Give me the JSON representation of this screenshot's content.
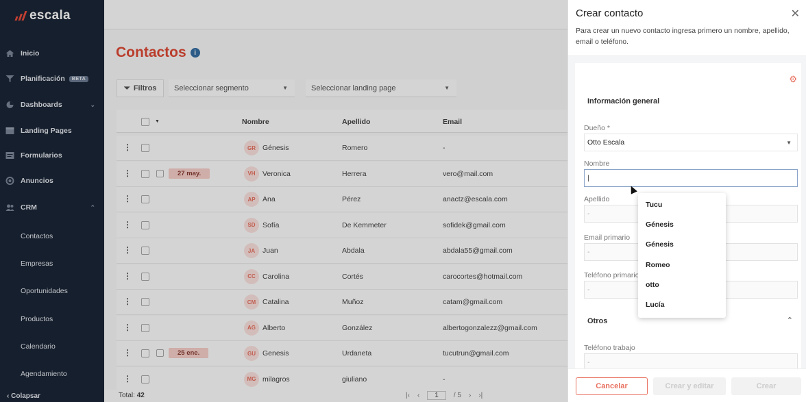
{
  "sidebar": {
    "brand": "escala",
    "nav": [
      {
        "label": "Inicio",
        "icon": "home-icon"
      },
      {
        "label": "Planificación",
        "icon": "filter-icon",
        "badge": "BETA"
      },
      {
        "label": "Dashboards",
        "icon": "pie-chart-icon"
      },
      {
        "label": "Landing Pages",
        "icon": "landing-page-icon"
      },
      {
        "label": "Formularios",
        "icon": "form-icon"
      },
      {
        "label": "Anuncios",
        "icon": "ads-icon"
      },
      {
        "label": "CRM",
        "icon": "users-icon"
      }
    ],
    "crm_items": [
      "Contactos",
      "Empresas",
      "Oportunidades",
      "Productos",
      "Calendario",
      "Agendamiento"
    ],
    "collapse_label": "Colapsar"
  },
  "main": {
    "title": "Contactos",
    "filters_label": "Filtros",
    "segment_placeholder": "Seleccionar segmento",
    "landing_placeholder": "Seleccionar landing page",
    "columns": [
      "Nombre",
      "Apellido",
      "Email"
    ],
    "rows": [
      {
        "initials": "GR",
        "name": "Génesis",
        "last": "Romero",
        "email": "-",
        "date": ""
      },
      {
        "initials": "VH",
        "name": "Veronica",
        "last": "Herrera",
        "email": "vero@mail.com",
        "date": "27 may."
      },
      {
        "initials": "AP",
        "name": "Ana",
        "last": "Pérez",
        "email": "anactz@escala.com",
        "date": ""
      },
      {
        "initials": "SD",
        "name": "Sofía",
        "last": "De Kemmeter",
        "email": "sofidek@gmail.com",
        "date": ""
      },
      {
        "initials": "JA",
        "name": "Juan",
        "last": "Abdala",
        "email": "abdala55@gmail.com",
        "date": ""
      },
      {
        "initials": "CC",
        "name": "Carolina",
        "last": "Cortés",
        "email": "carocortes@hotmail.com",
        "date": ""
      },
      {
        "initials": "CM",
        "name": "Catalina",
        "last": "Muñoz",
        "email": "catam@gmail.com",
        "date": ""
      },
      {
        "initials": "AG",
        "name": "Alberto",
        "last": "González",
        "email": "albertogonzalezz@gmail.com",
        "date": ""
      },
      {
        "initials": "GU",
        "name": "Genesis",
        "last": "Urdaneta",
        "email": "tucutrun@gmail.com",
        "date": "25 ene."
      },
      {
        "initials": "MG",
        "name": "milagros",
        "last": "giuliano",
        "email": "-",
        "date": ""
      }
    ],
    "total_label": "Total:",
    "total_value": "42",
    "page_current": "1",
    "page_total": "/ 5"
  },
  "drawer": {
    "title": "Crear contacto",
    "subtitle": "Para crear un nuevo contacto ingresa primero un nombre, apellido, email o teléfono.",
    "section_general": "Información general",
    "owner_label": "Dueño *",
    "owner_value": "Otto Escala",
    "name_label": "Nombre",
    "name_value": "|",
    "last_label": "Apellido",
    "last_placeholder": "-",
    "email_label": "Email primario",
    "email_placeholder": "-",
    "phone_label": "Teléfono primario",
    "phone_placeholder": "-",
    "section_other": "Otros",
    "work_phone_label": "Teléfono trabajo",
    "work_phone_placeholder": "-",
    "cancel_label": "Cancelar",
    "create_edit_label": "Crear y editar",
    "create_label": "Crear"
  },
  "suggestions": [
    "Tucu",
    "Génesis",
    "Génesis",
    "Romeo",
    "otto",
    "Lucía"
  ],
  "colors": {
    "accent": "#e04a36",
    "sidebar": "#1b2637"
  }
}
